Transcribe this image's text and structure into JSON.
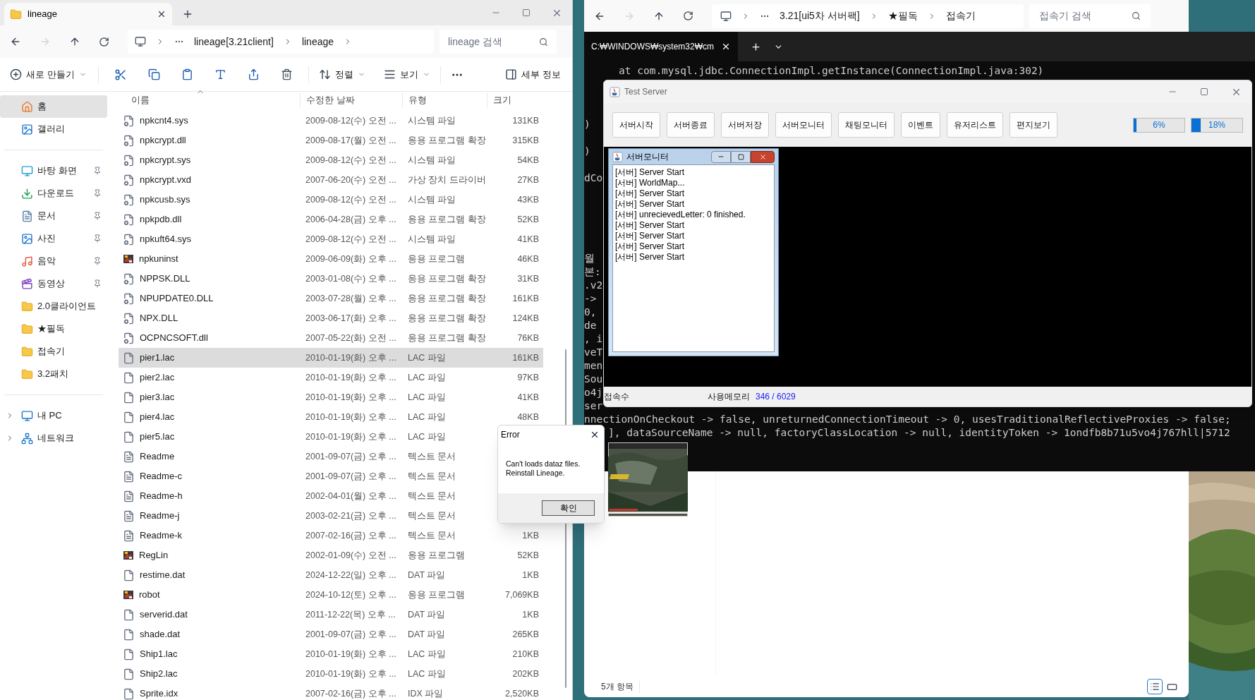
{
  "explorer": {
    "tab": {
      "title": "lineage"
    },
    "address": [
      "lineage[3.21client]",
      "lineage"
    ],
    "search": {
      "placeholder": "lineage 검색"
    },
    "toolbar": {
      "new": "새로 만들기",
      "sort": "정렬",
      "view": "보기",
      "details": "세부 정보"
    },
    "sidebar": {
      "groups": [
        [
          {
            "kind": "home",
            "label": "홈",
            "selected": true,
            "pinned": false
          },
          {
            "kind": "gallery",
            "label": "갤러리",
            "selected": false,
            "pinned": false
          }
        ],
        [
          {
            "kind": "desktop",
            "label": "바탕 화면",
            "selected": false,
            "pinned": true
          },
          {
            "kind": "download",
            "label": "다운로드",
            "selected": false,
            "pinned": true
          },
          {
            "kind": "documents",
            "label": "문서",
            "selected": false,
            "pinned": true
          },
          {
            "kind": "pictures",
            "label": "사진",
            "selected": false,
            "pinned": true
          },
          {
            "kind": "music",
            "label": "음악",
            "selected": false,
            "pinned": true
          },
          {
            "kind": "videos",
            "label": "동영상",
            "selected": false,
            "pinned": true
          },
          {
            "kind": "folder",
            "label": "2.0클라이언트",
            "selected": false,
            "pinned": false
          },
          {
            "kind": "folder",
            "label": "★필독",
            "selected": false,
            "pinned": false
          },
          {
            "kind": "folder",
            "label": "접속기",
            "selected": false,
            "pinned": false
          },
          {
            "kind": "folder",
            "label": "3.2패치",
            "selected": false,
            "pinned": false
          }
        ],
        [
          {
            "kind": "pc",
            "label": "내 PC",
            "selected": false,
            "pinned": false,
            "expanded": false
          },
          {
            "kind": "network",
            "label": "네트워크",
            "selected": false,
            "pinned": false,
            "expanded": false
          }
        ]
      ]
    },
    "columns": [
      "이름",
      "수정한 날짜",
      "유형",
      "크기"
    ],
    "files": [
      {
        "kind": "system",
        "name": "npkcnt4.sys",
        "date": "2009-08-12(수) 오전 ...",
        "type": "시스템 파일",
        "size": "131KB",
        "selected": false
      },
      {
        "kind": "system",
        "name": "npkcrypt.dll",
        "date": "2009-08-17(월) 오전 ...",
        "type": "응용 프로그램 확장",
        "size": "315KB",
        "selected": false
      },
      {
        "kind": "system",
        "name": "npkcrypt.sys",
        "date": "2009-08-12(수) 오전 ...",
        "type": "시스템 파일",
        "size": "54KB",
        "selected": false
      },
      {
        "kind": "system",
        "name": "npkcrypt.vxd",
        "date": "2007-06-20(수) 오전 ...",
        "type": "가상 장치 드라이버",
        "size": "27KB",
        "selected": false
      },
      {
        "kind": "system",
        "name": "npkcusb.sys",
        "date": "2009-08-12(수) 오전 ...",
        "type": "시스템 파일",
        "size": "43KB",
        "selected": false
      },
      {
        "kind": "system",
        "name": "npkpdb.dll",
        "date": "2006-04-28(금) 오후 ...",
        "type": "응용 프로그램 확장",
        "size": "52KB",
        "selected": false
      },
      {
        "kind": "system",
        "name": "npkuft64.sys",
        "date": "2009-08-12(수) 오전 ...",
        "type": "시스템 파일",
        "size": "41KB",
        "selected": false
      },
      {
        "kind": "app",
        "name": "npkuninst",
        "date": "2009-06-09(화) 오후 ...",
        "type": "응용 프로그램",
        "size": "46KB",
        "selected": false
      },
      {
        "kind": "system",
        "name": "NPPSK.DLL",
        "date": "2003-01-08(수) 오후 ...",
        "type": "응용 프로그램 확장",
        "size": "31KB",
        "selected": false
      },
      {
        "kind": "system",
        "name": "NPUPDATE0.DLL",
        "date": "2003-07-28(월) 오후 ...",
        "type": "응용 프로그램 확장",
        "size": "161KB",
        "selected": false
      },
      {
        "kind": "system",
        "name": "NPX.DLL",
        "date": "2003-06-17(화) 오후 ...",
        "type": "응용 프로그램 확장",
        "size": "124KB",
        "selected": false
      },
      {
        "kind": "system",
        "name": "OCPNCSOFT.dll",
        "date": "2007-05-22(화) 오전 ...",
        "type": "응용 프로그램 확장",
        "size": "76KB",
        "selected": false
      },
      {
        "kind": "plain",
        "name": "pier1.lac",
        "date": "2010-01-19(화) 오후 ...",
        "type": "LAC 파일",
        "size": "161KB",
        "selected": true
      },
      {
        "kind": "plain",
        "name": "pier2.lac",
        "date": "2010-01-19(화) 오후 ...",
        "type": "LAC 파일",
        "size": "97KB",
        "selected": false
      },
      {
        "kind": "plain",
        "name": "pier3.lac",
        "date": "2010-01-19(화) 오후 ...",
        "type": "LAC 파일",
        "size": "41KB",
        "selected": false
      },
      {
        "kind": "plain",
        "name": "pier4.lac",
        "date": "2010-01-19(화) 오후 ...",
        "type": "LAC 파일",
        "size": "48KB",
        "selected": false
      },
      {
        "kind": "plain",
        "name": "pier5.lac",
        "date": "2010-01-19(화) 오후 ...",
        "type": "LAC 파일",
        "selected": false
      },
      {
        "kind": "text",
        "name": "Readme",
        "date": "2001-09-07(금) 오후 ...",
        "type": "텍스트 문서",
        "selected": false
      },
      {
        "kind": "text",
        "name": "Readme-c",
        "date": "2001-09-07(금) 오후 ...",
        "type": "텍스트 문서",
        "selected": false
      },
      {
        "kind": "text",
        "name": "Readme-h",
        "date": "2002-04-01(월) 오후 ...",
        "type": "텍스트 문서",
        "selected": false
      },
      {
        "kind": "text",
        "name": "Readme-j",
        "date": "2003-02-21(금) 오후 ...",
        "type": "텍스트 문서",
        "selected": false
      },
      {
        "kind": "text",
        "name": "Readme-k",
        "date": "2007-02-16(금) 오후 ...",
        "type": "텍스트 문서",
        "size": "1KB",
        "selected": false
      },
      {
        "kind": "app",
        "name": "RegLin",
        "date": "2002-01-09(수) 오전 ...",
        "type": "응용 프로그램",
        "size": "52KB",
        "selected": false
      },
      {
        "kind": "plain",
        "name": "restime.dat",
        "date": "2024-12-22(일) 오후 ...",
        "type": "DAT 파일",
        "size": "1KB",
        "selected": false
      },
      {
        "kind": "app",
        "name": "robot",
        "date": "2024-10-12(토) 오후 ...",
        "type": "응용 프로그램",
        "size": "7,069KB",
        "selected": false
      },
      {
        "kind": "plain",
        "name": "serverid.dat",
        "date": "2011-12-22(목) 오후 ...",
        "type": "DAT 파일",
        "size": "1KB",
        "selected": false
      },
      {
        "kind": "plain",
        "name": "shade.dat",
        "date": "2001-09-07(금) 오후 ...",
        "type": "DAT 파일",
        "size": "265KB",
        "selected": false
      },
      {
        "kind": "plain",
        "name": "Ship1.lac",
        "date": "2010-01-19(화) 오후 ...",
        "type": "LAC 파일",
        "size": "210KB",
        "selected": false
      },
      {
        "kind": "plain",
        "name": "Ship2.lac",
        "date": "2010-01-19(화) 오후 ...",
        "type": "LAC 파일",
        "size": "202KB",
        "selected": false
      },
      {
        "kind": "plain",
        "name": "Sprite.idx",
        "date": "2007-02-16(금) 오후 ...",
        "type": "IDX 파일",
        "size": "2,520KB",
        "selected": false
      }
    ]
  },
  "back_explorer": {
    "address": [
      "3.21[ui5차 서버팩]",
      "★필독",
      "접속기"
    ],
    "search": {
      "placeholder": "접속기 검색"
    },
    "status": "5개 항목"
  },
  "terminal": {
    "tab": "C:₩WINDOWS₩system32₩cm",
    "lines": [
      "at com.mysql.jdbc.ConnectionImpl.getInstance(ConnectionImpl.java:302)",
      ")",
      ")",
      "dCo",
      "월",
      "본:",
      ".v2",
      "->",
      "0,",
      "de",
      ", i",
      "veT",
      "men",
      "Sou",
      "o4j",
      "ser",
      "nnectionOnCheckout -> false, unreturnedConnectionTimeout -> 0, usesTraditionalReflectiveProxies -> false;",
      "], dataSourceName -> null, factoryClassLocation -> null, identityToken -> 1ondfb8b71u5vo4j767hll|5712"
    ]
  },
  "test_server": {
    "title": "Test Server",
    "buttons": [
      "서버시작",
      "서버종료",
      "서버저장",
      "서버모니터",
      "채팅모니터",
      "이벤트",
      "유저리스트",
      "편지보기"
    ],
    "meters": [
      {
        "label": "6%",
        "level": 0.06
      },
      {
        "label": "18%",
        "level": 0.18
      }
    ],
    "status": {
      "users_label": "접속수",
      "memory_label": "사용메모리",
      "memory_value": "346 / 6029"
    }
  },
  "server_monitor": {
    "title": "서버모니터",
    "log": [
      "[서버] Server Start",
      "[서버] WorldMap...",
      "[서버] Server Start",
      "[서버] Server Start",
      "[서버] unrecievedLetter: 0 finished.",
      "[서버] Server Start",
      "[서버] Server Start",
      "[서버] Server Start",
      "[서버] Server Start"
    ]
  },
  "error_dialog": {
    "title": "Error",
    "message": [
      "Can't loads dataz files.",
      "Reinstall Lineage."
    ],
    "button": "확인"
  }
}
